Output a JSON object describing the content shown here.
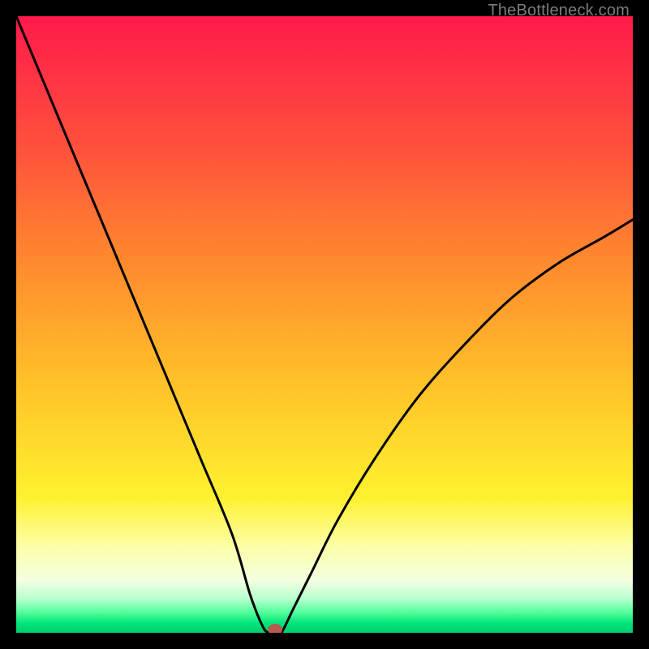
{
  "watermark": {
    "text": "TheBottleneck.com"
  },
  "chart_data": {
    "type": "line",
    "title": "",
    "xlabel": "",
    "ylabel": "",
    "xlim": [
      0,
      100
    ],
    "ylim": [
      0,
      100
    ],
    "grid": false,
    "legend": false,
    "series": [
      {
        "name": "curve",
        "x": [
          0,
          5,
          10,
          15,
          20,
          25,
          30,
          35,
          38,
          40,
          41,
          42,
          43,
          45,
          48,
          52,
          58,
          65,
          72,
          80,
          88,
          95,
          100
        ],
        "values": [
          100,
          88,
          76,
          64,
          52,
          40,
          28,
          16,
          6,
          1,
          0,
          0,
          0,
          4,
          10,
          18,
          28,
          38,
          46,
          54,
          60,
          64,
          67
        ]
      }
    ],
    "marker": {
      "x": 42,
      "y": 0,
      "color": "#b85a50"
    },
    "gradient_stops": [
      {
        "offset": 0.0,
        "color": "#ff1a4b"
      },
      {
        "offset": 0.2,
        "color": "#ff4d3d"
      },
      {
        "offset": 0.4,
        "color": "#ff8a2e"
      },
      {
        "offset": 0.6,
        "color": "#ffc329"
      },
      {
        "offset": 0.78,
        "color": "#fff12e"
      },
      {
        "offset": 0.86,
        "color": "#fdffa8"
      },
      {
        "offset": 0.915,
        "color": "#f3ffe0"
      },
      {
        "offset": 0.945,
        "color": "#b8ffcf"
      },
      {
        "offset": 0.965,
        "color": "#5aff9d"
      },
      {
        "offset": 0.985,
        "color": "#00e57a"
      },
      {
        "offset": 1.0,
        "color": "#00d070"
      }
    ]
  }
}
